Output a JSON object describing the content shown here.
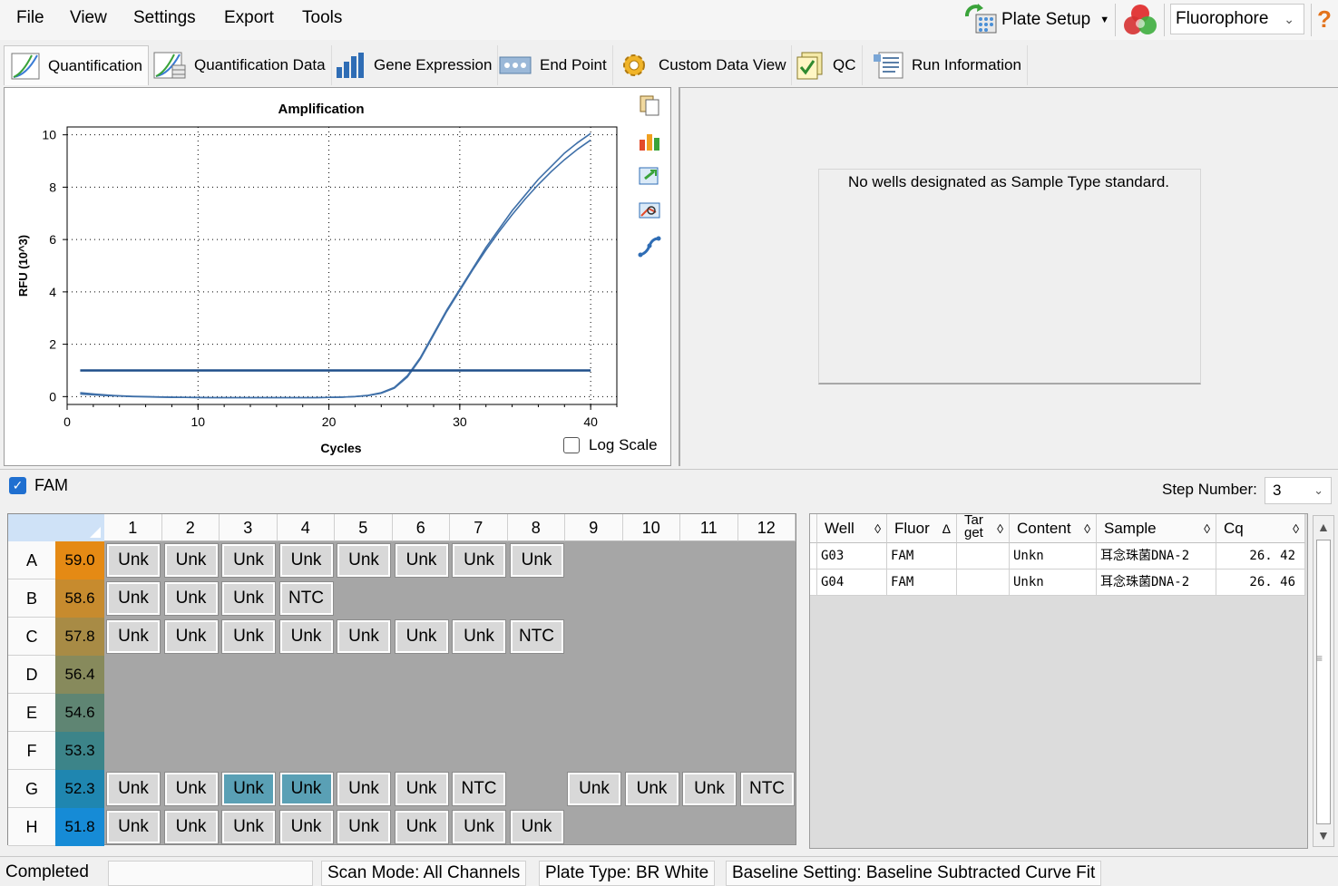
{
  "menu": {
    "file": "File",
    "view": "View",
    "settings": "Settings",
    "export": "Export",
    "tools": "Tools"
  },
  "toolbar": {
    "plate_setup": "Plate Setup",
    "fluorophore": "Fluorophore",
    "help": "?"
  },
  "tabs": {
    "quantification": "Quantification",
    "quantification_data": "Quantification Data",
    "gene_expression": "Gene Expression",
    "end_point": "End Point",
    "custom_data_view": "Custom Data View",
    "qc": "QC",
    "run_information": "Run Information"
  },
  "chart_data": {
    "type": "line",
    "title": "Amplification",
    "xlabel": "Cycles",
    "ylabel": "RFU (10^3)",
    "xlim": [
      0,
      42
    ],
    "ylim": [
      -0.3,
      10.3
    ],
    "xticks": [
      0,
      10,
      20,
      30,
      40
    ],
    "yticks": [
      0,
      2,
      4,
      6,
      8,
      10
    ],
    "grid": true,
    "log_scale": false,
    "threshold": 1.0,
    "x": [
      1,
      2,
      3,
      4,
      5,
      6,
      7,
      8,
      9,
      10,
      11,
      12,
      13,
      14,
      15,
      16,
      17,
      18,
      19,
      20,
      21,
      22,
      23,
      24,
      25,
      26,
      27,
      28,
      29,
      30,
      31,
      32,
      33,
      34,
      35,
      36,
      37,
      38,
      39,
      40
    ],
    "series": [
      {
        "values": [
          0.15,
          0.1,
          0.06,
          0.03,
          0.01,
          0.0,
          -0.01,
          -0.02,
          -0.03,
          -0.03,
          -0.04,
          -0.04,
          -0.04,
          -0.04,
          -0.04,
          -0.04,
          -0.04,
          -0.04,
          -0.04,
          -0.03,
          -0.02,
          0.0,
          0.05,
          0.15,
          0.35,
          0.8,
          1.5,
          2.4,
          3.3,
          4.1,
          4.9,
          5.7,
          6.4,
          7.1,
          7.7,
          8.3,
          8.8,
          9.3,
          9.7,
          10.05
        ]
      },
      {
        "values": [
          0.1,
          0.07,
          0.04,
          0.02,
          0.0,
          -0.01,
          -0.02,
          -0.03,
          -0.03,
          -0.04,
          -0.04,
          -0.04,
          -0.04,
          -0.04,
          -0.04,
          -0.04,
          -0.04,
          -0.04,
          -0.04,
          -0.03,
          -0.02,
          0.0,
          0.04,
          0.13,
          0.32,
          0.75,
          1.45,
          2.35,
          3.25,
          4.05,
          4.85,
          5.6,
          6.3,
          6.95,
          7.55,
          8.1,
          8.6,
          9.05,
          9.45,
          9.8
        ]
      }
    ],
    "colors": {
      "curve": "#3e6fa8",
      "threshold": "#1f4e8a"
    }
  },
  "log_scale_label": "Log Scale",
  "std_message": "No wells designated as Sample Type standard.",
  "fluor_filter": {
    "label": "FAM",
    "checked": true
  },
  "step": {
    "label": "Step Number:",
    "value": "3"
  },
  "plate": {
    "columns": [
      "1",
      "2",
      "3",
      "4",
      "5",
      "6",
      "7",
      "8",
      "9",
      "10",
      "11",
      "12"
    ],
    "rows": [
      {
        "label": "A",
        "temp": "59.0",
        "color": "#e58a14",
        "wells": [
          "Unk",
          "Unk",
          "Unk",
          "Unk",
          "Unk",
          "Unk",
          "Unk",
          "Unk",
          "",
          "",
          "",
          ""
        ]
      },
      {
        "label": "B",
        "temp": "58.6",
        "color": "#c78b2e",
        "wells": [
          "Unk",
          "Unk",
          "Unk",
          "NTC",
          "",
          "",
          "",
          "",
          "",
          "",
          "",
          ""
        ]
      },
      {
        "label": "C",
        "temp": "57.8",
        "color": "#a88b45",
        "wells": [
          "Unk",
          "Unk",
          "Unk",
          "Unk",
          "Unk",
          "Unk",
          "Unk",
          "NTC",
          "",
          "",
          "",
          ""
        ]
      },
      {
        "label": "D",
        "temp": "56.4",
        "color": "#878a5c",
        "wells": [
          "",
          "",
          "",
          "",
          "",
          "",
          "",
          "",
          "",
          "",
          "",
          ""
        ]
      },
      {
        "label": "E",
        "temp": "54.6",
        "color": "#5f8573",
        "wells": [
          "",
          "",
          "",
          "",
          "",
          "",
          "",
          "",
          "",
          "",
          "",
          ""
        ]
      },
      {
        "label": "F",
        "temp": "53.3",
        "color": "#3c8489",
        "wells": [
          "",
          "",
          "",
          "",
          "",
          "",
          "",
          "",
          "",
          "",
          "",
          ""
        ]
      },
      {
        "label": "G",
        "temp": "52.3",
        "color": "#1f86b0",
        "wells": [
          "Unk",
          "Unk",
          "Unk",
          "Unk",
          "Unk",
          "Unk",
          "NTC",
          "",
          "Unk",
          "Unk",
          "Unk",
          "NTC"
        ],
        "selected": [
          2,
          3
        ]
      },
      {
        "label": "H",
        "temp": "51.8",
        "color": "#168bd6",
        "wells": [
          "Unk",
          "Unk",
          "Unk",
          "Unk",
          "Unk",
          "Unk",
          "Unk",
          "Unk",
          "",
          "",
          "",
          ""
        ]
      }
    ]
  },
  "results": {
    "columns": [
      "Well",
      "Fluor",
      "Tar get",
      "Content",
      "Sample",
      "Cq"
    ],
    "rows": [
      [
        "G03",
        "FAM",
        "",
        "Unkn",
        "耳念珠菌DNA-2",
        "26. 42"
      ],
      [
        "G04",
        "FAM",
        "",
        "Unkn",
        "耳念珠菌DNA-2",
        "26. 46"
      ]
    ]
  },
  "status": {
    "state": "Completed",
    "scan_mode": "Scan Mode: All Channels",
    "plate_type": "Plate Type: BR White",
    "baseline": "Baseline Setting: Baseline Subtracted Curve Fit"
  }
}
